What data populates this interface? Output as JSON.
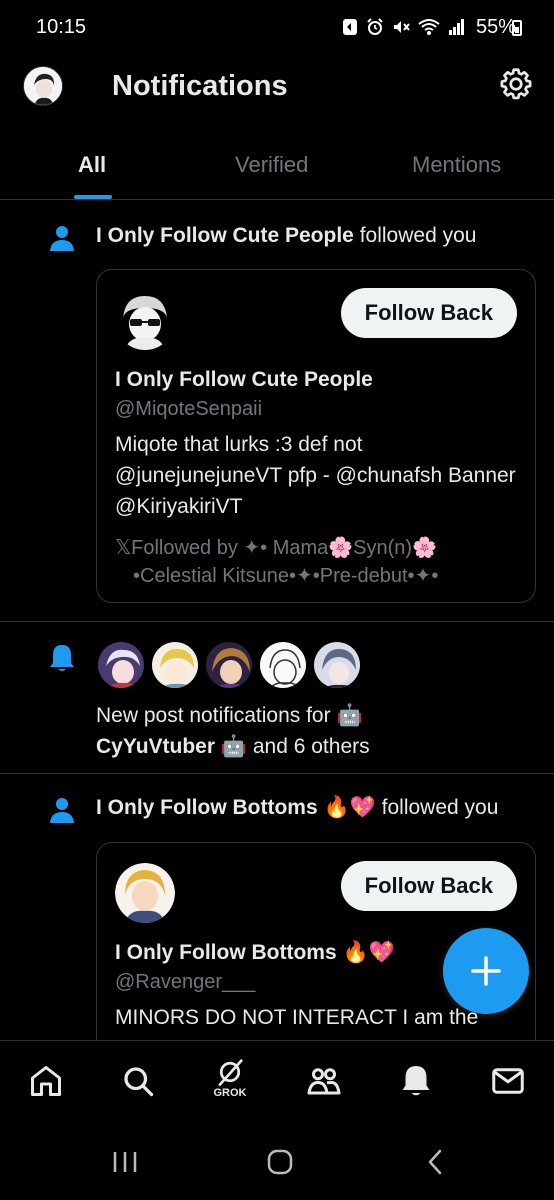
{
  "status_bar": {
    "time": "10:15",
    "battery": "55%"
  },
  "header": {
    "title": "Notifications"
  },
  "tabs": [
    {
      "label": "All",
      "active": true
    },
    {
      "label": "Verified",
      "active": false
    },
    {
      "label": "Mentions",
      "active": false
    }
  ],
  "notifications": [
    {
      "type": "follow",
      "actor": "I Only Follow Cute People",
      "action": "followed you",
      "card": {
        "name": "I Only Follow Cute People",
        "handle": "@MiqoteSenpaii",
        "bio": "Miqote that lurks :3 def not @junejunejuneVT pfp - @chunafsh Banner @KiriyakiriVT",
        "followed_by_line1": "𝕏Followed by ✦• Mama🌸Syn(n)🌸",
        "followed_by_line2": "•Celestial Kitsune•✦•Pre-debut•✦•",
        "button": "Follow Back"
      }
    },
    {
      "type": "new_post",
      "text_prefix": "New post notifications for 🤖",
      "actor": "CyYuVtuber 🤖",
      "text_suffix": "and 6 others"
    },
    {
      "type": "follow",
      "actor": "I Only Follow Bottoms 🔥💖",
      "action": "followed you",
      "card": {
        "name": "I Only Follow Bottoms 🔥💖",
        "handle": "@Ravenger___",
        "bio": "MINORS DO NOT INTERACT I am the",
        "button": "Follow Back"
      }
    }
  ],
  "bottom_nav": {
    "grok_label": "GROK"
  },
  "colors": {
    "accent": "#1d9bf0",
    "background": "#000000",
    "divider": "#2f3336",
    "muted": "#71767b"
  }
}
